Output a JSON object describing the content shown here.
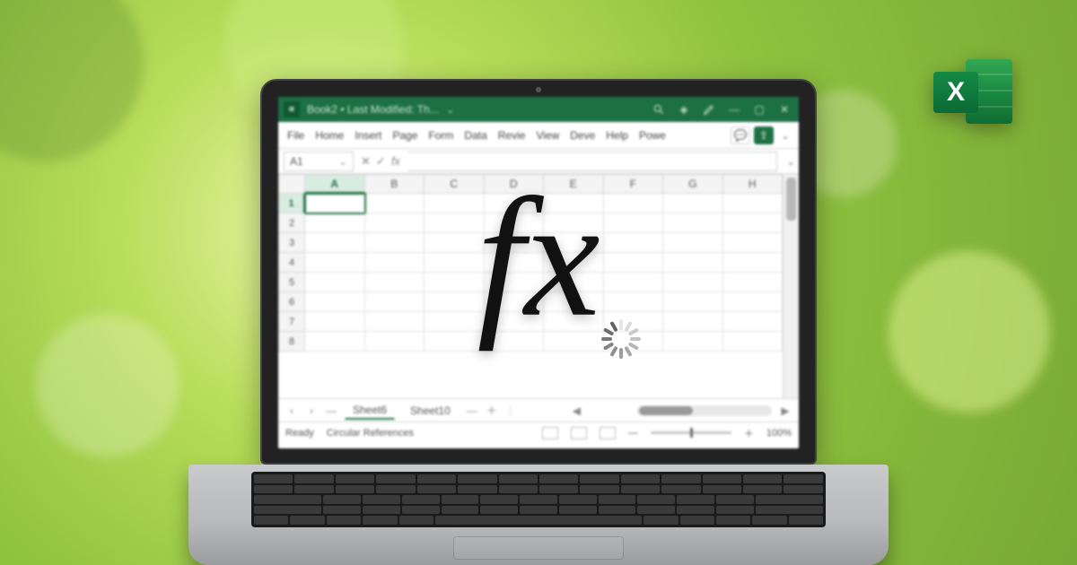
{
  "titlebar": {
    "document_title": "Book2 • Last Modified: Th..."
  },
  "ribbon": {
    "tabs": [
      "File",
      "Home",
      "Insert",
      "Page",
      "Form",
      "Data",
      "Revie",
      "View",
      "Deve",
      "Help",
      "Powe"
    ]
  },
  "formulabar": {
    "namebox_value": "A1",
    "fx_label": "fx"
  },
  "grid": {
    "columns": [
      "A",
      "B",
      "C",
      "D",
      "E",
      "F",
      "G",
      "H"
    ],
    "rows": [
      "1",
      "2",
      "3",
      "4",
      "5",
      "6",
      "7",
      "8"
    ],
    "selected_cell": "A1"
  },
  "sheetbar": {
    "sheets": [
      "Sheet6",
      "Sheet10"
    ]
  },
  "statusbar": {
    "ready_label": "Ready",
    "circular_label": "Circular References",
    "zoom_label": "100%"
  },
  "overlay": {
    "fx_text": "fx"
  },
  "badge": {
    "letter": "X"
  }
}
